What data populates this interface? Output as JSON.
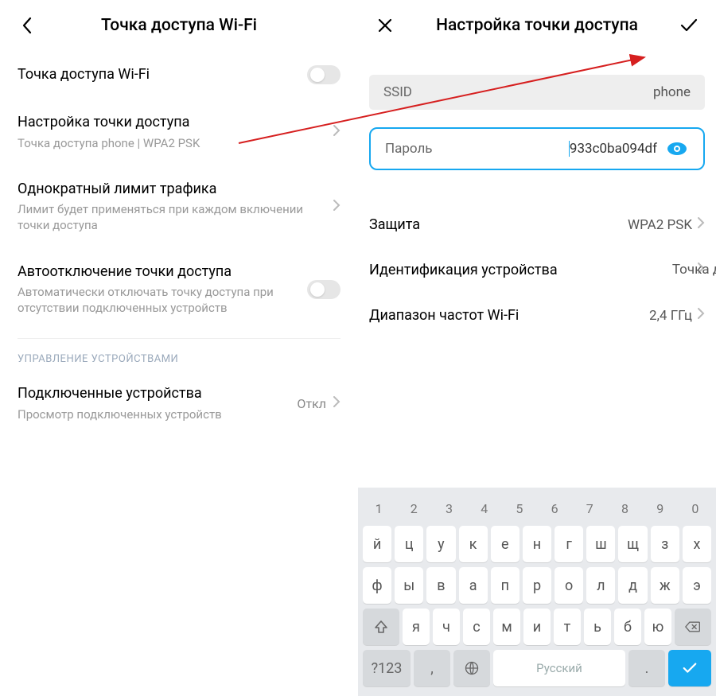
{
  "left": {
    "title": "Точка доступа Wi-Fi",
    "rows": {
      "hotspot": {
        "label": "Точка доступа Wi-Fi"
      },
      "setup": {
        "label": "Настройка точки доступа",
        "sub": "Точка доступа phone | WPA2 PSK"
      },
      "limit": {
        "label": "Однократный лимит трафика",
        "sub": "Лимит будет применяться при каждом включении точки доступа"
      },
      "auto": {
        "label": "Автоотключение точки доступа",
        "sub": "Автоматически отключать точку доступа при отсутствии подключенных устройств"
      }
    },
    "section": "УПРАВЛЕНИЕ УСТРОЙСТВАМИ",
    "connected": {
      "label": "Подключенные устройства",
      "sub": "Просмотр подключенных устройств",
      "value": "Откл"
    }
  },
  "right": {
    "title": "Настройка точки доступа",
    "ssid": {
      "label": "SSID",
      "value": "phone"
    },
    "password": {
      "label": "Пароль",
      "value": "933c0ba094df"
    },
    "security": {
      "label": "Защита",
      "value": "WPA2 PSK"
    },
    "ident": {
      "label": "Идентификация устройства",
      "value": "Точка доступа"
    },
    "band": {
      "label": "Диапазон частот Wi-Fi",
      "value": "2,4 ГГц"
    }
  },
  "keyboard": {
    "nums": [
      "1",
      "2",
      "3",
      "4",
      "5",
      "6",
      "7",
      "8",
      "9",
      "0"
    ],
    "row1": [
      "й",
      "ц",
      "у",
      "к",
      "е",
      "н",
      "г",
      "ш",
      "щ",
      "з",
      "х"
    ],
    "row2": [
      "ф",
      "ы",
      "в",
      "а",
      "п",
      "р",
      "о",
      "л",
      "д",
      "ж",
      "э"
    ],
    "row3": [
      "я",
      "ч",
      "с",
      "м",
      "и",
      "т",
      "ь",
      "б",
      "ю"
    ],
    "sym": "?123",
    "comma": ",",
    "space": "Русский",
    "dot": "."
  }
}
